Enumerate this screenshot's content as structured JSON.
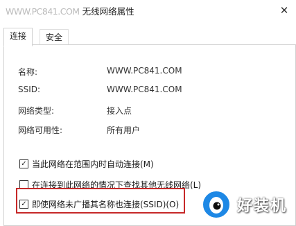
{
  "window": {
    "title_prefix": "WWW.PC841.COM",
    "title": "无线网络属性",
    "close_glyph": "✕"
  },
  "tabs": [
    {
      "label": "连接",
      "active": true
    },
    {
      "label": "安全",
      "active": false
    }
  ],
  "info": {
    "name_label": "名称:",
    "name_value": "WWW.PC841.COM",
    "ssid_label": "SSID:",
    "ssid_value": "WWW.PC841.COM",
    "type_label": "网络类型:",
    "type_value": "接入点",
    "availability_label": "网络可用性:",
    "availability_value": "所有用户"
  },
  "options": [
    {
      "label": "当此网络在范围内时自动连接(M)",
      "checked": true
    },
    {
      "label": "在连接到此网络的情况下查找其他无线网络(L)",
      "checked": false
    },
    {
      "label": "即使网络未广播其名称也连接(SSID)(O)",
      "checked": true
    }
  ],
  "check_glyph": "✓",
  "watermark": {
    "text": "好装机",
    "icon": "eye-logo-icon"
  },
  "colors": {
    "highlight": "#c62828",
    "logo_blue": "#1e88e5"
  }
}
